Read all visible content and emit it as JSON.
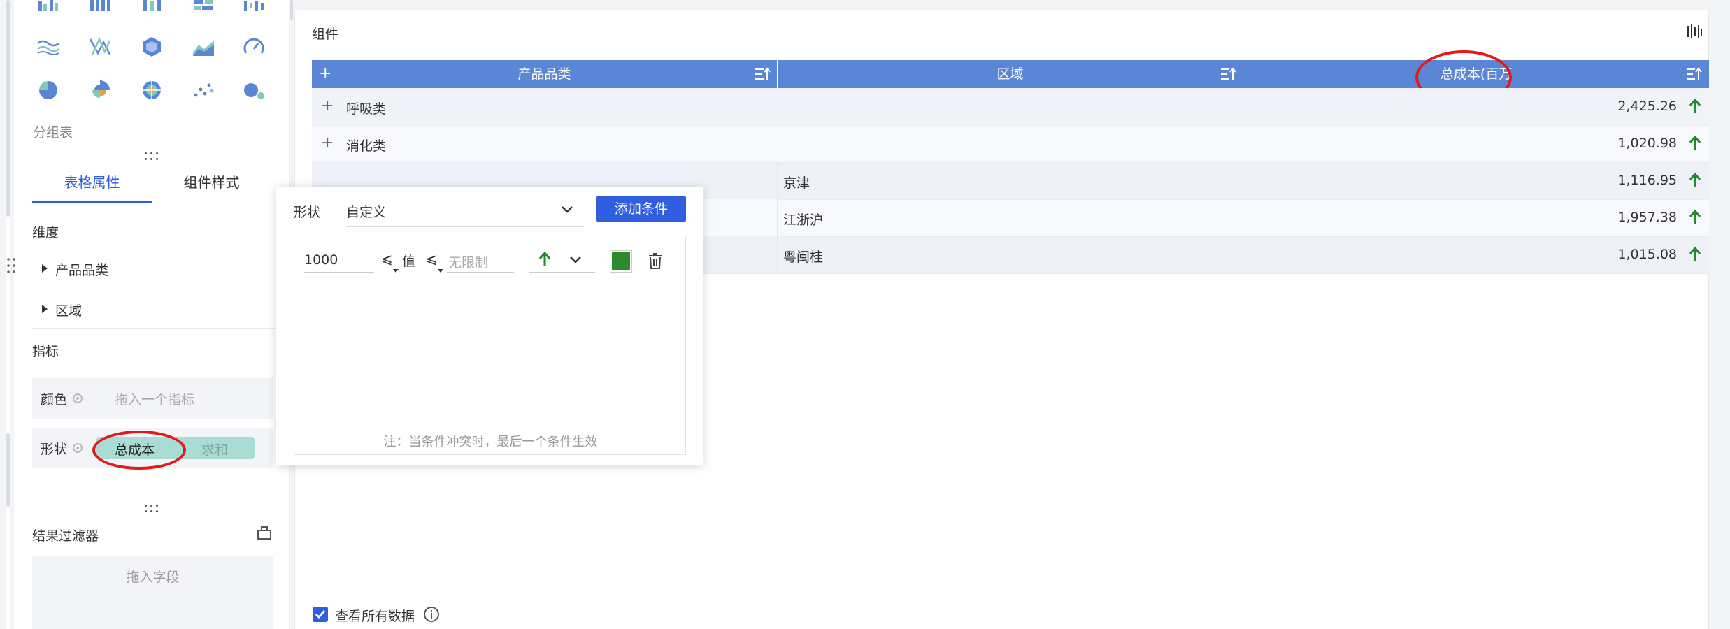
{
  "sidebar": {
    "chart_icons": [
      {
        "name": "grouped-bar-icon"
      },
      {
        "name": "bar-chart-icon"
      },
      {
        "name": "stacked-bar-icon"
      },
      {
        "name": "horizontal-bar-icon"
      },
      {
        "name": "waterfall-icon"
      },
      {
        "name": "line-chart-icon"
      },
      {
        "name": "radar-icon"
      },
      {
        "name": "hexagon-icon"
      },
      {
        "name": "area-chart-icon"
      },
      {
        "name": "gauge-icon"
      },
      {
        "name": "pie-chart-icon"
      },
      {
        "name": "rose-chart-icon"
      },
      {
        "name": "sunburst-icon"
      },
      {
        "name": "scatter-icon"
      },
      {
        "name": "bubble-icon"
      }
    ],
    "chart_type_label": "分组表",
    "tabs": {
      "properties": "表格属性",
      "style": "组件样式"
    },
    "dimension_title": "维度",
    "dimensions": [
      "产品品类",
      "区域"
    ],
    "metric_title": "指标",
    "color_label": "颜色",
    "color_placeholder": "拖入一个指标",
    "shape_label": "形状",
    "shape_field": "总成本",
    "shape_agg": "求和",
    "filter_title": "结果过滤器",
    "filter_placeholder": "拖入字段"
  },
  "main": {
    "component_title": "组件",
    "columns": [
      "产品品类",
      "区域",
      "总成本(百万"
    ],
    "rows": [
      {
        "category": "呼吸类",
        "region": "",
        "value": "2,425.26",
        "expand": "+"
      },
      {
        "category": "消化类",
        "region": "",
        "value": "1,020.98",
        "expand": "+"
      },
      {
        "category": "",
        "region": "京津",
        "value": "1,116.95",
        "expand": ""
      },
      {
        "category": "",
        "region": "江浙沪",
        "value": "1,957.38",
        "expand": ""
      },
      {
        "category": "",
        "region": "粤闽桂",
        "value": "1,015.08",
        "expand": ""
      }
    ],
    "view_all_label": "查看所有数据"
  },
  "popup": {
    "shape_label": "形状",
    "shape_value": "自定义",
    "add_condition": "添加条件",
    "min_value": "1000",
    "op1": "⩽",
    "value_label": "值",
    "op2": "⩽",
    "max_placeholder": "无限制",
    "note": "注：当条件冲突时，最后一个条件生效"
  },
  "colors": {
    "accent": "#2f5fe0",
    "header": "#5b86d6",
    "arrow_green": "#1e8a2e",
    "pill": "#a8dcd5",
    "annotation_red": "#e21a1a"
  }
}
